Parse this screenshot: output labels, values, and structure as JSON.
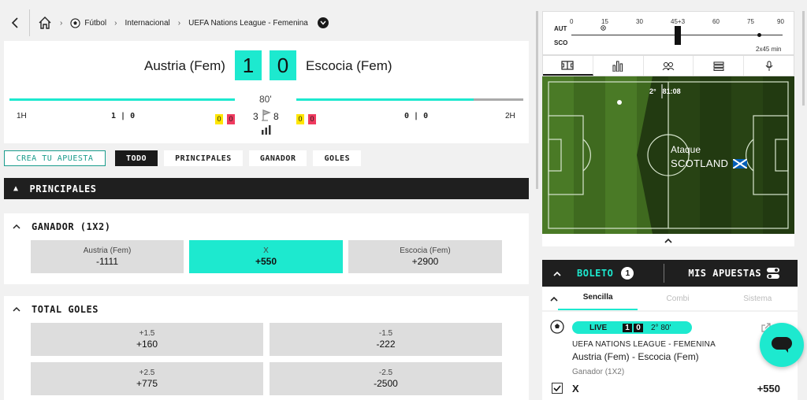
{
  "breadcrumb": {
    "items": [
      "Fútbol",
      "Internacional",
      "UEFA Nations League - Femenina"
    ]
  },
  "match": {
    "home": "Austria (Fem)",
    "away": "Escocia (Fem)",
    "home_score": "1",
    "away_score": "0",
    "minute": "80'",
    "first_half_label": "1H",
    "second_half_label": "2H",
    "first_half_score": "1 | 0",
    "second_half_score": "0 | 0",
    "home_yellow": "0",
    "home_red": "0",
    "away_yellow": "0",
    "away_red": "0",
    "corners_home": "3",
    "corners_away": "8",
    "progress_fraction": 0.89
  },
  "tabs": [
    "CREA TU APUESTA",
    "TODO",
    "PRINCIPALES",
    "GANADOR",
    "GOLES"
  ],
  "section_title": "PRINCIPALES",
  "markets": {
    "ganador": {
      "title": "GANADOR (1X2)",
      "options": [
        {
          "label": "Austria (Fem)",
          "odds": "-1111"
        },
        {
          "label": "X",
          "odds": "+550"
        },
        {
          "label": "Escocia (Fem)",
          "odds": "+2900"
        }
      ]
    },
    "total_goles": {
      "title": "TOTAL GOLES",
      "options": [
        {
          "label": "+1.5",
          "odds": "+160"
        },
        {
          "label": "-1.5",
          "odds": "-222"
        },
        {
          "label": "+2.5",
          "odds": "+775"
        },
        {
          "label": "-2.5",
          "odds": "-2500"
        }
      ]
    }
  },
  "timeline": {
    "ticks": [
      "0",
      "15",
      "30",
      "45+3",
      "60",
      "75",
      "90"
    ],
    "home_abbr": "AUT",
    "away_abbr": "SCO",
    "duration": "2x45 min"
  },
  "pitch": {
    "period": "2°",
    "clock": "81:08",
    "state": "Ataque",
    "team": "SCOTLAND"
  },
  "boleto": {
    "title": "BOLETO",
    "count": "1",
    "mis_apuestas": "MIS APUESTAS",
    "subtabs": [
      "Sencilla",
      "Combi",
      "Sistema"
    ]
  },
  "bet": {
    "live": "LIVE",
    "score_home": "1",
    "score_away": "0",
    "time": "2° 80'",
    "league": "UEFA NATIONS LEAGUE - FEMENINA",
    "event": "Austria (Fem) - Escocia (Fem)",
    "market": "Ganador (1X2)",
    "selection": "X",
    "odds": "+550"
  },
  "colors": {
    "accent": "#1de9cf",
    "dark": "#1f1f1f",
    "yellow_card": "#ffe600",
    "red_card": "#f03a5f",
    "pitch": "#3f6a1f"
  }
}
